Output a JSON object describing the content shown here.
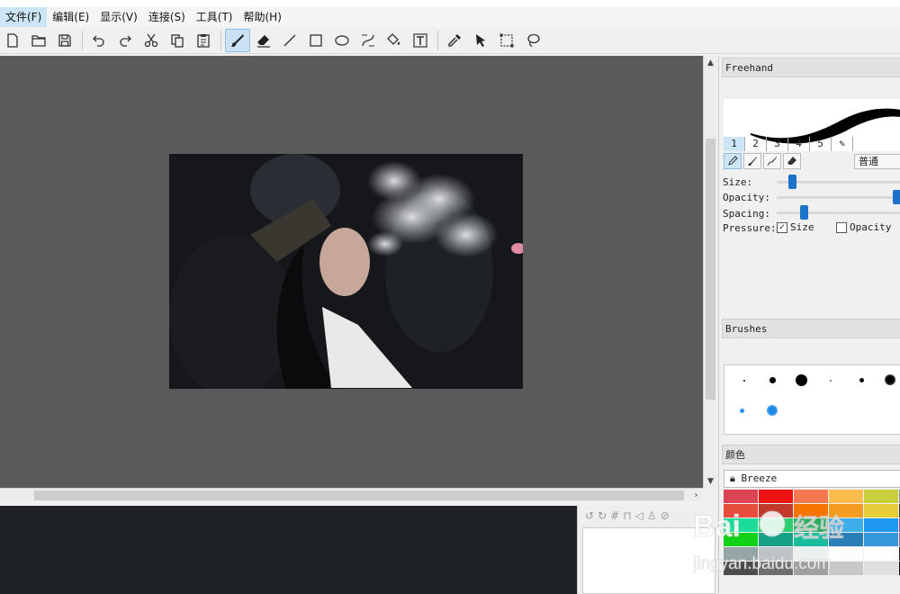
{
  "menu": [
    "文件(F)",
    "编辑(E)",
    "显示(V)",
    "连接(S)",
    "工具(T)",
    "帮助(H)"
  ],
  "toolbar": {
    "groups": [
      [
        "new-document-icon",
        "open-folder-icon",
        "save-icon"
      ],
      [
        "undo-icon",
        "redo-icon",
        "cut-icon",
        "copy-icon",
        "paste-icon"
      ],
      [
        "freehand-brush-icon",
        "eraser-icon",
        "line-icon",
        "rectangle-icon",
        "ellipse-icon",
        "bezier-icon",
        "fill-bucket-icon",
        "text-icon"
      ],
      [
        "color-picker-icon",
        "move-pointer-icon",
        "rectangle-select-icon",
        "lasso-icon"
      ]
    ],
    "active": "freehand-brush-icon"
  },
  "panel_freehand": {
    "title": "Freehand",
    "tabs": [
      "1",
      "2",
      "3",
      "4",
      "5"
    ],
    "selected_tab": "1",
    "blend_mode": "普通",
    "size_label": "Size:",
    "opacity_label": "Opacity:",
    "spacing_label": "Spacing:",
    "pressure_label": "Pressure:",
    "pressure_size_label": "Size",
    "pressure_size_checked": true,
    "pressure_opacity_label": "Opacity",
    "pressure_opacity_checked": false,
    "size_value": 0.1,
    "opacity_value": 1.0,
    "spacing_value": 0.2
  },
  "panel_brushes": {
    "title": "Brushes"
  },
  "panel_colors": {
    "title": "颜色",
    "palette_name": "Breeze",
    "swatches": [
      "#da4453",
      "#ed1515",
      "#f47750",
      "#fdbc4b",
      "#c9ce3b",
      "#7f8c8d",
      "#e74c3c",
      "#c0392b",
      "#f67400",
      "#f39c1f",
      "#e6cd38",
      "#31363b",
      "#1cdc9a",
      "#2ecc71",
      "#27ae60",
      "#3daee9",
      "#1d99f3",
      "#8e44ad",
      "#11d116",
      "#16a085",
      "#1abc9c",
      "#2980b9",
      "#3498db",
      "#9b59b6",
      "#95a5a6",
      "#bdc3c7",
      "#ecf0f1",
      "#fcfcfc",
      "#ffffff",
      "#232629",
      "#4d4d4d",
      "#6e6e6e",
      "#a0a0a0",
      "#c8c8c8",
      "#e0e0e0",
      "#000000"
    ]
  },
  "watermark": {
    "brand": "Bai",
    "brand_cn": "经验",
    "url": "jingyan.baidu.com"
  }
}
